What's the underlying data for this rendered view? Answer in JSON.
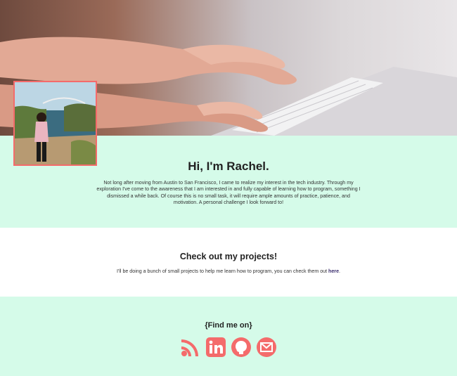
{
  "about": {
    "heading": "Hi, I'm Rachel.",
    "paragraph": "Not long after moving from Austin to San Francisco, I came to realize my interest in the tech industry. Through my exploration I've come to the awareness that I am interested in and fully capable of learning how to program, something I dismissed a while back. Of course this is no small task, it will require ample amounts of practice, patience, and motivation. A personal challenge I look forward to!"
  },
  "projects": {
    "heading": "Check out my projects!",
    "text": "I'll be doing a bunch of small projects to help me learn how to program, you can check them out ",
    "link_label": "here",
    "trailing": "."
  },
  "find_me": {
    "heading": "{Find me on}",
    "icons": [
      "rss-icon",
      "linkedin-icon",
      "github-icon",
      "mail-icon"
    ]
  },
  "colors": {
    "accent": "#f46b6b",
    "mint": "#d5fbe9",
    "link": "#3b2e6e"
  }
}
